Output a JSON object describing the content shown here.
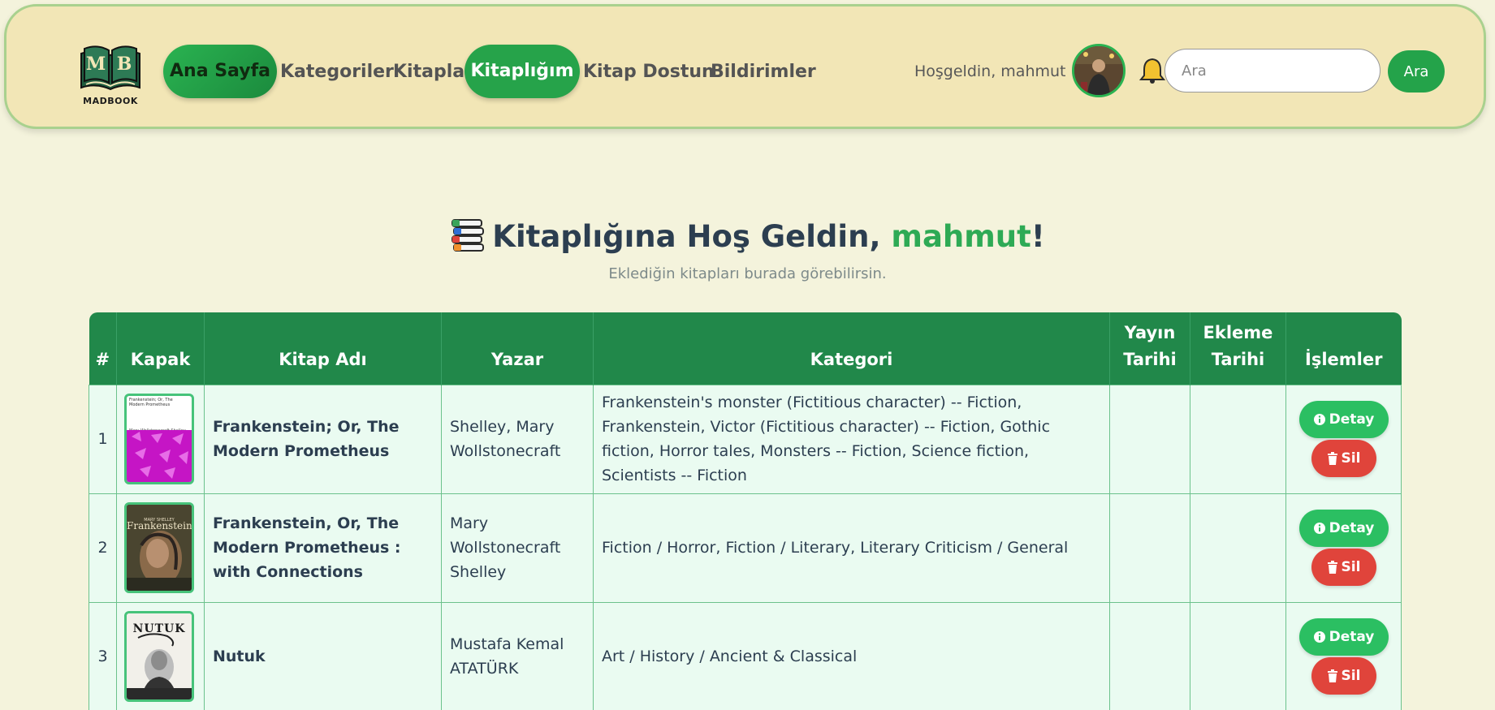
{
  "logo": {
    "initials_left": "M",
    "initials_right": "B",
    "name": "MADBOOK"
  },
  "nav": {
    "home": "Ana Sayfa",
    "categories": "Kategoriler",
    "books": "Kitaplar",
    "library": "Kitaplığım",
    "book_friend": "Kitap Dostun",
    "notifications": "Bildirimler"
  },
  "header": {
    "welcome": "Hoşgeldin, mahmut",
    "search_placeholder": "Ara",
    "search_button": "Ara"
  },
  "page": {
    "title_prefix": "Kitaplığına Hoş Geldin, ",
    "title_user": "mahmut",
    "title_suffix": "!",
    "subtitle": "Eklediğin kitapları burada görebilirsin."
  },
  "table": {
    "headers": {
      "num": "#",
      "cover": "Kapak",
      "title": "Kitap Adı",
      "author": "Yazar",
      "category": "Kategori",
      "pub_line1": "Yayın",
      "pub_line2": "Tarihi",
      "added_line1": "Ekleme",
      "added_line2": "Tarihi",
      "actions": "İşlemler"
    },
    "rows": [
      {
        "num": "1",
        "cover_text": "Frankenstein; Or, The Modern Prometheus",
        "cover_author": "Mary Wollstonecraft Shelley",
        "title": "Frankenstein; Or, The Modern Prometheus",
        "author": "Shelley, Mary Wollstonecraft",
        "category": "Frankenstein's monster (Fictitious character) -- Fiction, Frankenstein, Victor (Fictitious character) -- Fiction, Gothic fiction, Horror tales, Monsters -- Fiction, Science fiction, Scientists -- Fiction",
        "pub_date": "",
        "added_date": "",
        "detail": "Detay",
        "delete": "Sil"
      },
      {
        "num": "2",
        "cover_text": "Frankenstein",
        "cover_author": "MARY SHELLEY",
        "title": "Frankenstein, Or, The Modern Prometheus : with Connections",
        "author": "Mary Wollstonecraft Shelley",
        "category": "Fiction / Horror, Fiction / Literary, Literary Criticism / General",
        "pub_date": "",
        "added_date": "",
        "detail": "Detay",
        "delete": "Sil"
      },
      {
        "num": "3",
        "cover_text": "NUTUK",
        "cover_author": "",
        "title": "Nutuk",
        "author": "Mustafa Kemal ATATÜRK",
        "category": "Art / History / Ancient & Classical",
        "pub_date": "",
        "added_date": "",
        "detail": "Detay",
        "delete": "Sil"
      }
    ]
  },
  "colors": {
    "background": "#f4f3dc",
    "navbar": "#f2e6b6",
    "accent": "#21884a",
    "detail_button": "#2bbf62",
    "delete_button": "#e0443b"
  },
  "icons": [
    "book-logo-icon",
    "bell-icon",
    "books-stack-icon",
    "info-icon",
    "trash-icon"
  ]
}
